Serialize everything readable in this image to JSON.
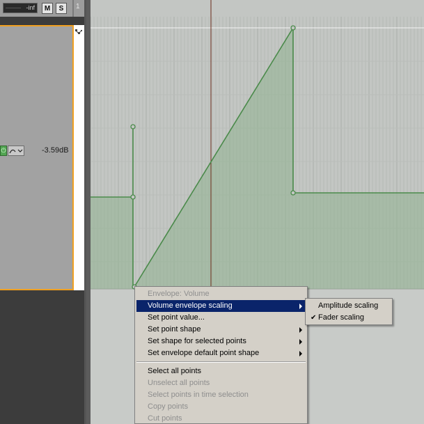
{
  "track": {
    "volume_meter": "-inf",
    "mute_label": "M",
    "solo_label": "S",
    "number": "1",
    "envelope_value": "-3.59dB"
  },
  "icons": {
    "arm": "power-icon",
    "shape": "curve-shape-icon",
    "envelope_side": "points-icon"
  },
  "colors": {
    "envelope_line": "#4a8a4a",
    "envelope_fill": "#8fb38f",
    "selection_border": "#f0a020",
    "cursor": "#6a2a1a",
    "menu_highlight": "#0a246a"
  },
  "context_menu": {
    "title": "Envelope: Volume",
    "items": [
      {
        "label": "Volume envelope scaling"
      },
      {
        "label": "Set point value..."
      },
      {
        "label": "Set point shape"
      },
      {
        "label": "Set shape for selected points"
      },
      {
        "label": "Set envelope default point shape"
      },
      {
        "label": "Select all points"
      },
      {
        "label": "Unselect all points"
      },
      {
        "label": "Select points in time selection"
      },
      {
        "label": "Copy points"
      },
      {
        "label": "Cut points"
      }
    ]
  },
  "submenu": {
    "items": [
      {
        "label": "Amplitude scaling"
      },
      {
        "label": "Fader scaling",
        "check": "✔"
      }
    ]
  }
}
